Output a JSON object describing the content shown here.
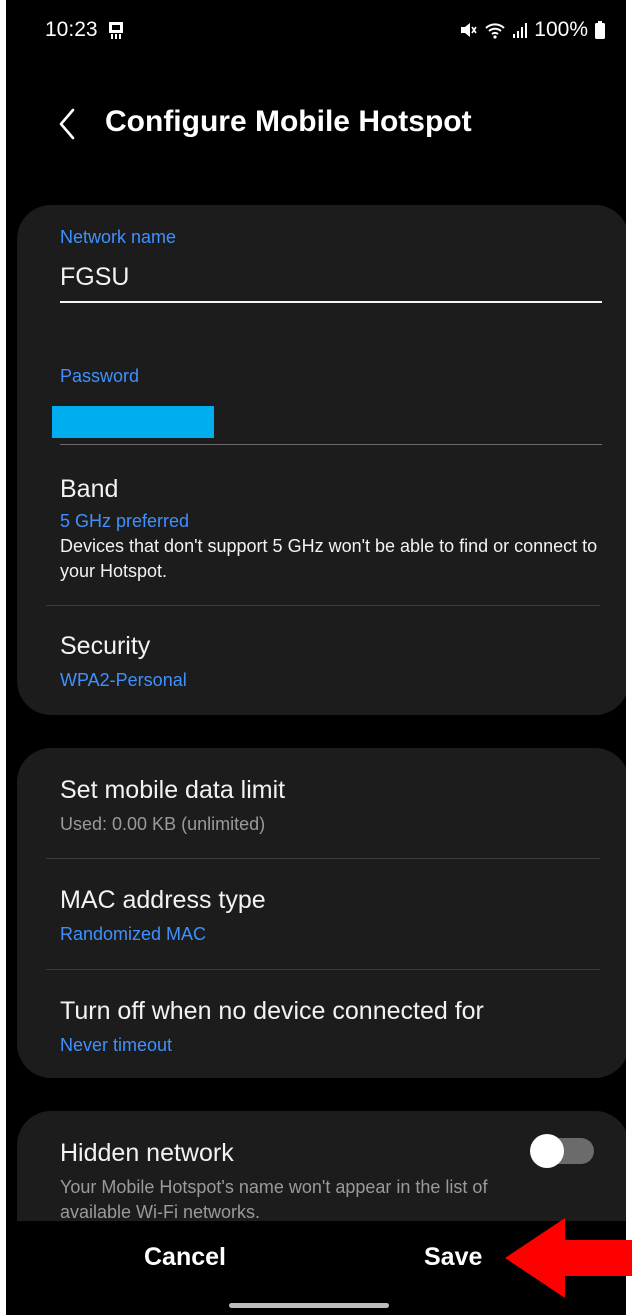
{
  "status_bar": {
    "time": "10:23",
    "battery": "100%"
  },
  "header": {
    "title": "Configure Mobile Hotspot"
  },
  "network": {
    "name_label": "Network name",
    "name_value": "FGSU",
    "password_label": "Password"
  },
  "band": {
    "title": "Band",
    "value": "5 GHz preferred",
    "description": "Devices that don't support 5 GHz won't be able to find or connect to your Hotspot."
  },
  "security": {
    "title": "Security",
    "value": "WPA2-Personal"
  },
  "data_limit": {
    "title": "Set mobile data limit",
    "value": "Used: 0.00 KB (unlimited)"
  },
  "mac": {
    "title": "MAC address type",
    "value": "Randomized MAC"
  },
  "timeout": {
    "title": "Turn off when no device connected for",
    "value": "Never timeout"
  },
  "hidden": {
    "title": "Hidden network",
    "description": "Your Mobile Hotspot's name won't appear in the list of available Wi-Fi networks.",
    "enabled": false
  },
  "actions": {
    "cancel": "Cancel",
    "save": "Save"
  },
  "colors": {
    "accent": "#3e91ff",
    "card": "#1c1c1c",
    "background": "#000000",
    "annotation_arrow": "#ff0000",
    "redaction": "#00aef0"
  },
  "icons": [
    "mute-icon",
    "wifi-icon",
    "signal-icon",
    "battery-icon",
    "screenshot-icon",
    "back-icon"
  ]
}
